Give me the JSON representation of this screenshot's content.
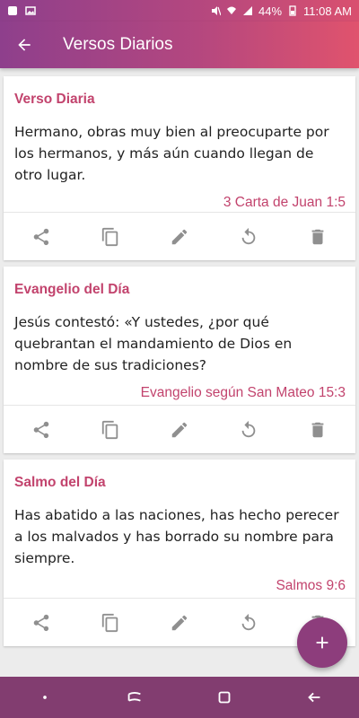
{
  "status": {
    "battery": "44%",
    "time": "11:08 AM"
  },
  "appbar": {
    "title": "Versos Diarios"
  },
  "cards": [
    {
      "title": "Verso Diaria",
      "text": "Hermano, obras muy bien al preocuparte por los hermanos, y más aún cuando llegan de otro lugar.",
      "reference": "3 Carta de Juan 1:5"
    },
    {
      "title": "Evangelio del Día",
      "text": "Jesús contestó: «Y ustedes, ¿por qué quebrantan el mandamiento de Dios en nombre de sus tradiciones?",
      "reference": "Evangelio según San Mateo 15:3"
    },
    {
      "title": "Salmo del Día",
      "text": "Has abatido a las naciones, has hecho perecer a los malvados y has borrado su nombre para siempre.",
      "reference": "Salmos 9:6"
    }
  ],
  "actions": [
    "share-icon",
    "copy-icon",
    "edit-icon",
    "refresh-icon",
    "delete-icon"
  ],
  "fab": {
    "icon": "add-icon"
  },
  "colors": {
    "accent": "#c2436d",
    "bar_start": "#8e3f8c",
    "bar_end": "#e0536d",
    "fab": "#8d3d7c",
    "navbar": "#823d70"
  }
}
